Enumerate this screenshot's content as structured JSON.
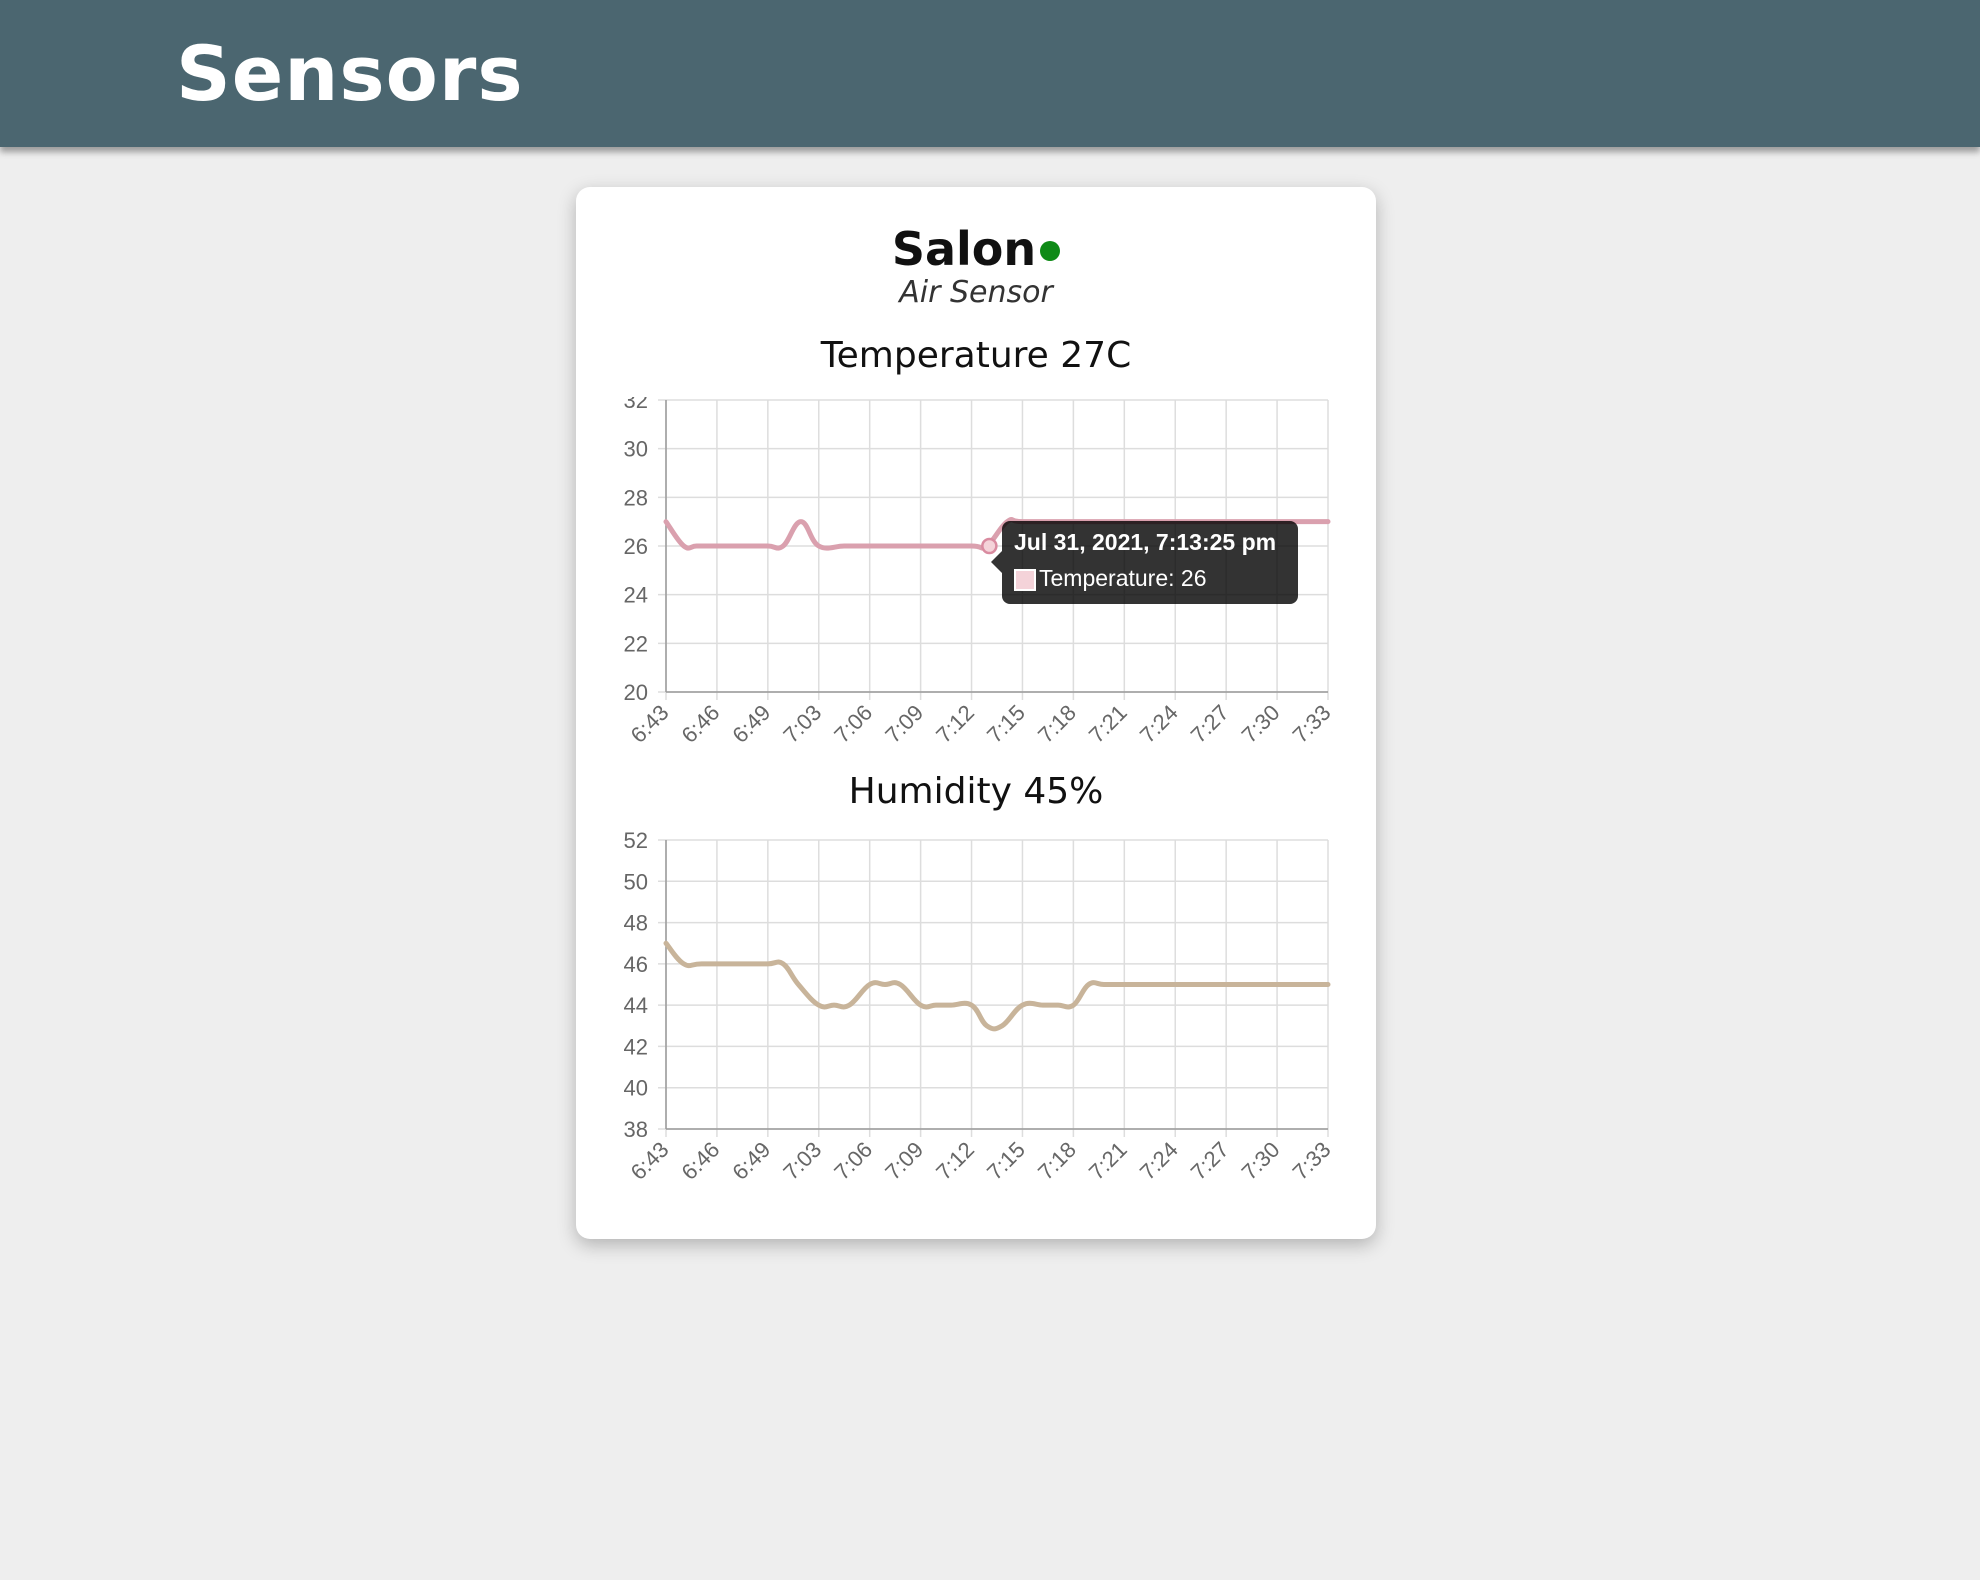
{
  "header": {
    "title": "Sensors",
    "color": "#4b6670"
  },
  "sensor": {
    "name": "Salon",
    "type": "Air Sensor",
    "status_color": "#0e8a16",
    "status_icon": "online-dot-icon"
  },
  "charts": {
    "temperature": {
      "title": "Temperature 27C"
    },
    "humidity": {
      "title": "Humidity 45%"
    }
  },
  "tooltip": {
    "title": "Jul 31, 2021, 7:13:25 pm",
    "label": "Temperature: 26",
    "swatch_color": "#f4d3d9"
  },
  "chart_data": [
    {
      "type": "line",
      "title": "Temperature 27C",
      "color": "#daa0ae",
      "x_ticks": [
        "6:43",
        "6:46",
        "6:49",
        "7:03",
        "7:06",
        "7:09",
        "7:12",
        "7:15",
        "7:18",
        "7:21",
        "7:24",
        "7:27",
        "7:30",
        "7:33"
      ],
      "ylim": [
        20,
        32
      ],
      "y_ticks": [
        20,
        22,
        24,
        26,
        28,
        30,
        32
      ],
      "grid": true,
      "series": [
        {
          "x": [
            0,
            0.35,
            0.6,
            1.0,
            1.5,
            2.0,
            2.3,
            2.65,
            3.0,
            3.5,
            4.0,
            5.0,
            6.0,
            6.3,
            6.7,
            7.0,
            8.0,
            9.0,
            10.0,
            11.0,
            12.0,
            13.0
          ],
          "values": [
            27,
            26,
            26,
            26,
            26,
            26,
            26,
            27,
            26,
            26,
            26,
            26,
            26,
            26,
            27,
            27,
            27,
            27,
            27,
            27,
            27,
            27
          ]
        }
      ],
      "highlight": {
        "x": 6.35,
        "value": 26
      }
    },
    {
      "type": "line",
      "title": "Humidity 45%",
      "color": "#c8b49a",
      "x_ticks": [
        "6:43",
        "6:46",
        "6:49",
        "7:03",
        "7:06",
        "7:09",
        "7:12",
        "7:15",
        "7:18",
        "7:21",
        "7:24",
        "7:27",
        "7:30",
        "7:33"
      ],
      "ylim": [
        38,
        52
      ],
      "y_ticks": [
        38,
        40,
        42,
        44,
        46,
        48,
        50,
        52
      ],
      "grid": true,
      "series": [
        {
          "x": [
            0,
            0.35,
            0.7,
            1.5,
            2.0,
            2.3,
            2.6,
            3.0,
            3.3,
            3.6,
            4.0,
            4.3,
            4.6,
            5.0,
            5.3,
            5.6,
            6.0,
            6.3,
            6.6,
            7.0,
            7.4,
            7.7,
            8.0,
            8.3,
            8.6,
            9.0,
            10.0,
            11.0,
            12.0,
            13.0
          ],
          "values": [
            47,
            46,
            46,
            46,
            46,
            46,
            45,
            44,
            44,
            44,
            45,
            45,
            45,
            44,
            44,
            44,
            44,
            43,
            43,
            44,
            44,
            44,
            44,
            45,
            45,
            45,
            45,
            45,
            45,
            45
          ]
        }
      ]
    }
  ]
}
